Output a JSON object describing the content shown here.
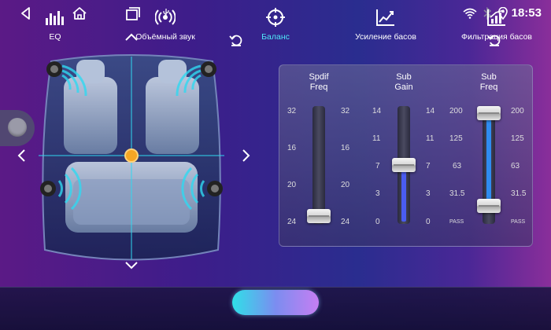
{
  "status_bar": {
    "time": "18:53",
    "icons": [
      "back-icon",
      "home-icon",
      "recent-apps-icon",
      "usb-icon",
      "wifi-icon",
      "bluetooth-icon",
      "location-icon"
    ]
  },
  "balance": {
    "arrows": [
      "arrow-up-icon",
      "arrow-down-icon",
      "arrow-left-icon",
      "arrow-right-icon"
    ],
    "reset_icon": "reset-icon",
    "accent": "#2fd8f0",
    "dot_color": "#f5a623"
  },
  "sliders": [
    {
      "title_line1": "Spdif",
      "title_line2": "Freq",
      "ticks_left": [
        "32",
        "16",
        "20",
        "24"
      ],
      "ticks_right": [
        "32",
        "16",
        "20",
        "24"
      ],
      "level": 0.0,
      "fill": false
    },
    {
      "title_line1": "Sub",
      "title_line2": "Gain",
      "ticks_left": [
        "14",
        "11",
        "7",
        "3",
        "0"
      ],
      "ticks_right": [
        "14",
        "11",
        "7",
        "3",
        "0"
      ],
      "level": 0.5,
      "fill": true,
      "fill_color": "#4a5cf0"
    },
    {
      "title_line1": "Sub",
      "title_line2": "Freq",
      "ticks_left": [
        "200",
        "125",
        "63",
        "31.5",
        "PASS"
      ],
      "ticks_right": [
        "200",
        "125",
        "63",
        "31.5",
        "PASS"
      ],
      "level": 1.0,
      "level_low": 0.1,
      "fill": true,
      "fill_color": "#2f8cf0"
    }
  ],
  "bottom_nav": [
    {
      "label": "EQ",
      "icon": "equalizer-icon",
      "active": false
    },
    {
      "label": "Объёмный звук",
      "icon": "surround-icon",
      "active": false
    },
    {
      "label": "Баланс",
      "icon": "balance-target-icon",
      "active": true
    },
    {
      "label": "Усиление басов",
      "icon": "bass-boost-icon",
      "active": false
    },
    {
      "label": "Фильтрация басов",
      "icon": "bass-filter-icon",
      "active": false
    }
  ]
}
